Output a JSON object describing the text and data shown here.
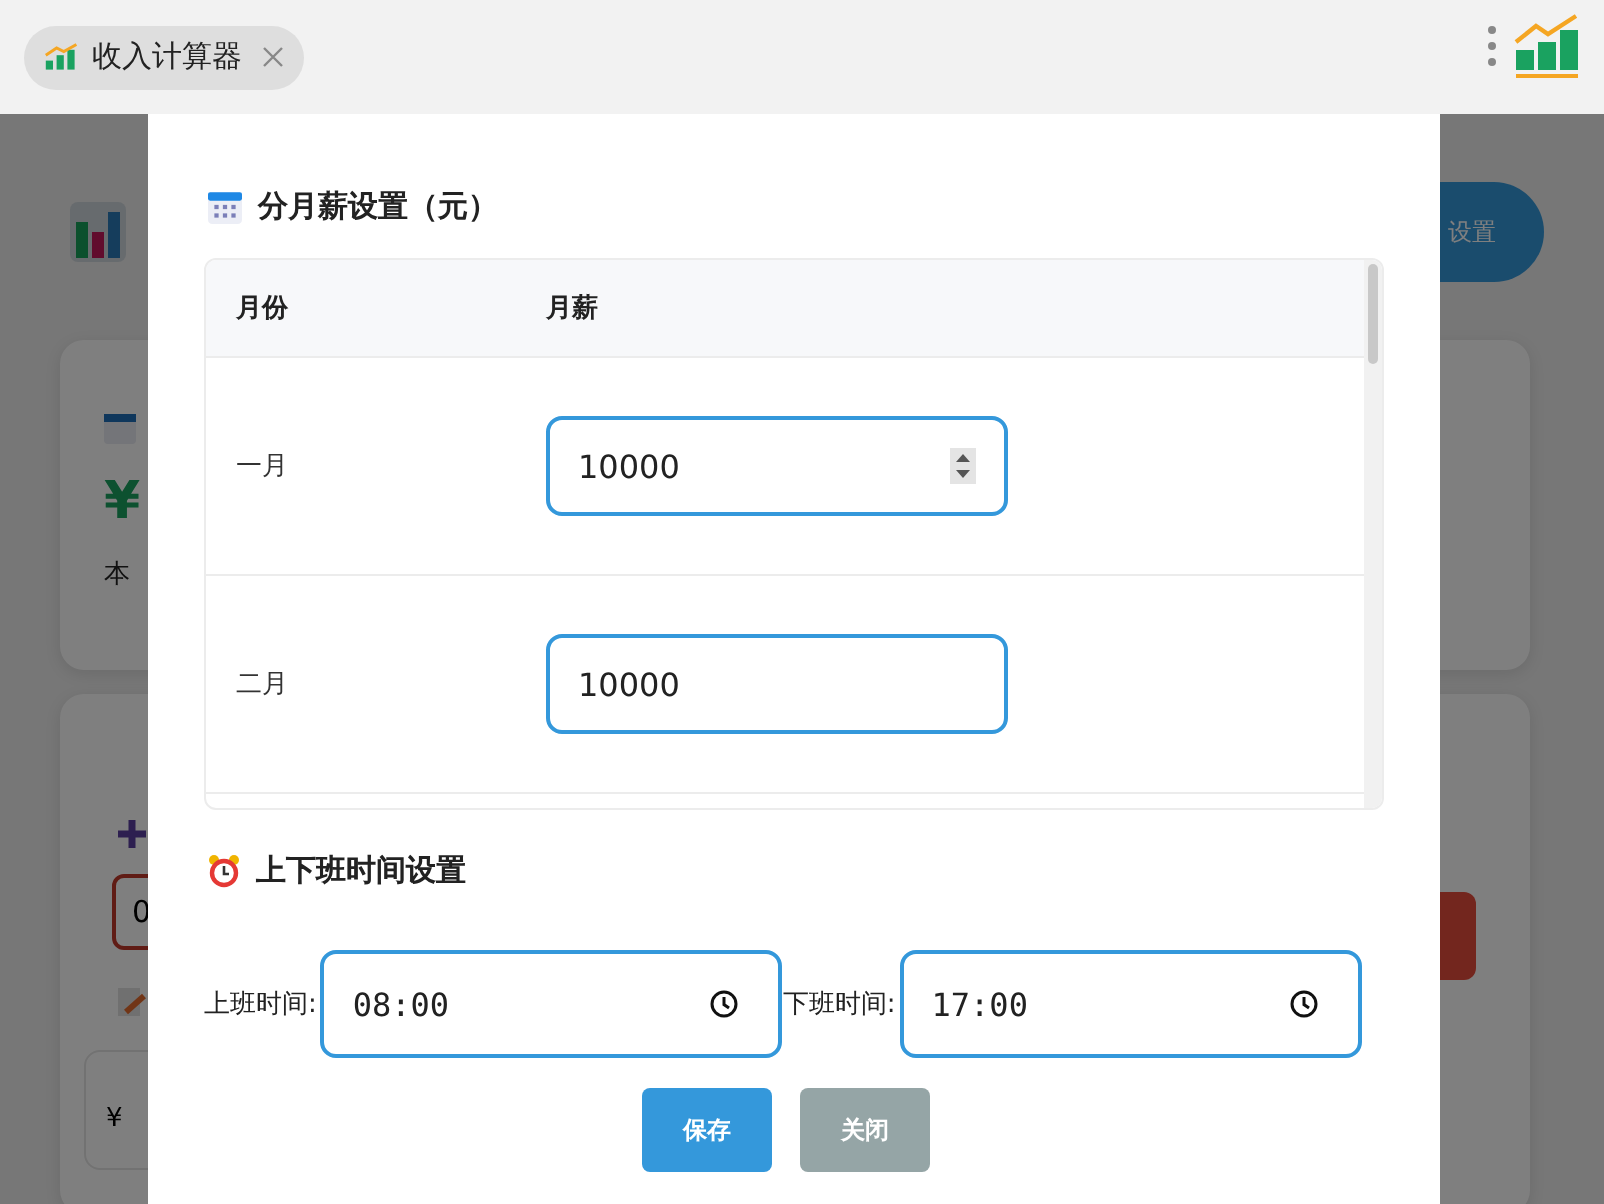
{
  "tab": {
    "title": "收入计算器"
  },
  "background": {
    "settings_button": "设置",
    "summary_card": {
      "amount": "¥",
      "caption": "本"
    },
    "entry_card": {
      "field_value": "0",
      "list_amount": "¥"
    }
  },
  "dialog": {
    "salary_section": {
      "title": "分月薪设置（元）",
      "columns": [
        "月份",
        "月薪"
      ],
      "rows": [
        {
          "month": "一月",
          "salary": "10000",
          "hovered": true
        },
        {
          "month": "二月",
          "salary": "10000",
          "hovered": false
        }
      ]
    },
    "time_section": {
      "title": "上下班时间设置",
      "fields": [
        {
          "label": "上班时间:",
          "value": "08:00"
        },
        {
          "label": "下班时间:",
          "value": "17:00"
        }
      ]
    },
    "buttons": [
      {
        "label": "保存",
        "kind": "primary"
      },
      {
        "label": "关闭",
        "kind": "secondary"
      }
    ]
  }
}
